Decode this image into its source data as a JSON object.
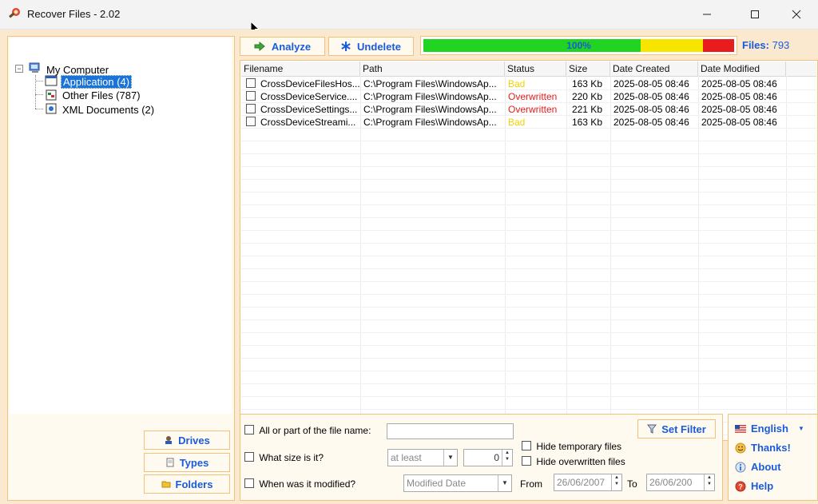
{
  "window": {
    "title": "Recover Files - 2.02",
    "minimize_icon": "minimize-icon",
    "maximize_icon": "maximize-icon",
    "close_icon": "close-icon"
  },
  "tree": {
    "root": "My Computer",
    "items": [
      {
        "label": "Application (4)",
        "selected": true
      },
      {
        "label": "Other Files (787)",
        "selected": false
      },
      {
        "label": "XML Documents (2)",
        "selected": false
      }
    ]
  },
  "left_buttons": {
    "drives": "Drives",
    "types": "Types",
    "folders": "Folders"
  },
  "toolbar": {
    "analyze": "Analyze",
    "undelete": "Undelete"
  },
  "progress": {
    "text": "100%",
    "value": 1.0,
    "colors": [
      "#22d422",
      "#f7e500",
      "#e81c1c"
    ]
  },
  "files": {
    "label": "Files:",
    "count": "793"
  },
  "grid": {
    "columns": [
      "Filename",
      "Path",
      "Status",
      "Size",
      "Date Created",
      "Date Modified"
    ],
    "rows": [
      {
        "filename": "CrossDeviceFilesHos...",
        "path": "C:\\Program Files\\WindowsAp...",
        "status": "Bad",
        "status_color": "#f2d200",
        "size": "163 Kb",
        "created": "2025-08-05 08:46",
        "modified": "2025-08-05 08:46"
      },
      {
        "filename": "CrossDeviceService....",
        "path": "C:\\Program Files\\WindowsAp...",
        "status": "Overwritten",
        "status_color": "#e81c1c",
        "size": "220 Kb",
        "created": "2025-08-05 08:46",
        "modified": "2025-08-05 08:46"
      },
      {
        "filename": "CrossDeviceSettings...",
        "path": "C:\\Program Files\\WindowsAp...",
        "status": "Overwritten",
        "status_color": "#e81c1c",
        "size": "221 Kb",
        "created": "2025-08-05 08:46",
        "modified": "2025-08-05 08:46"
      },
      {
        "filename": "CrossDeviceStreami...",
        "path": "C:\\Program Files\\WindowsAp...",
        "status": "Bad",
        "status_color": "#f2d200",
        "size": "163 Kb",
        "created": "2025-08-05 08:46",
        "modified": "2025-08-05 08:46"
      }
    ]
  },
  "filter": {
    "name_label": "All or part of the file name:",
    "name_value": "",
    "size_label": "What size is it?",
    "size_mode": "at least",
    "size_value": "0",
    "modified_label": "When was it modified?",
    "modified_mode": "Modified Date",
    "from_label": "From",
    "from_value": "26/06/2007",
    "to_label": "To",
    "to_value": "26/06/200",
    "hide_temp": "Hide temporary files",
    "hide_overwritten": "Hide overwritten files",
    "set_filter": "Set Filter"
  },
  "side_menu": {
    "language": "English",
    "thanks": "Thanks!",
    "about": "About",
    "help": "Help"
  }
}
